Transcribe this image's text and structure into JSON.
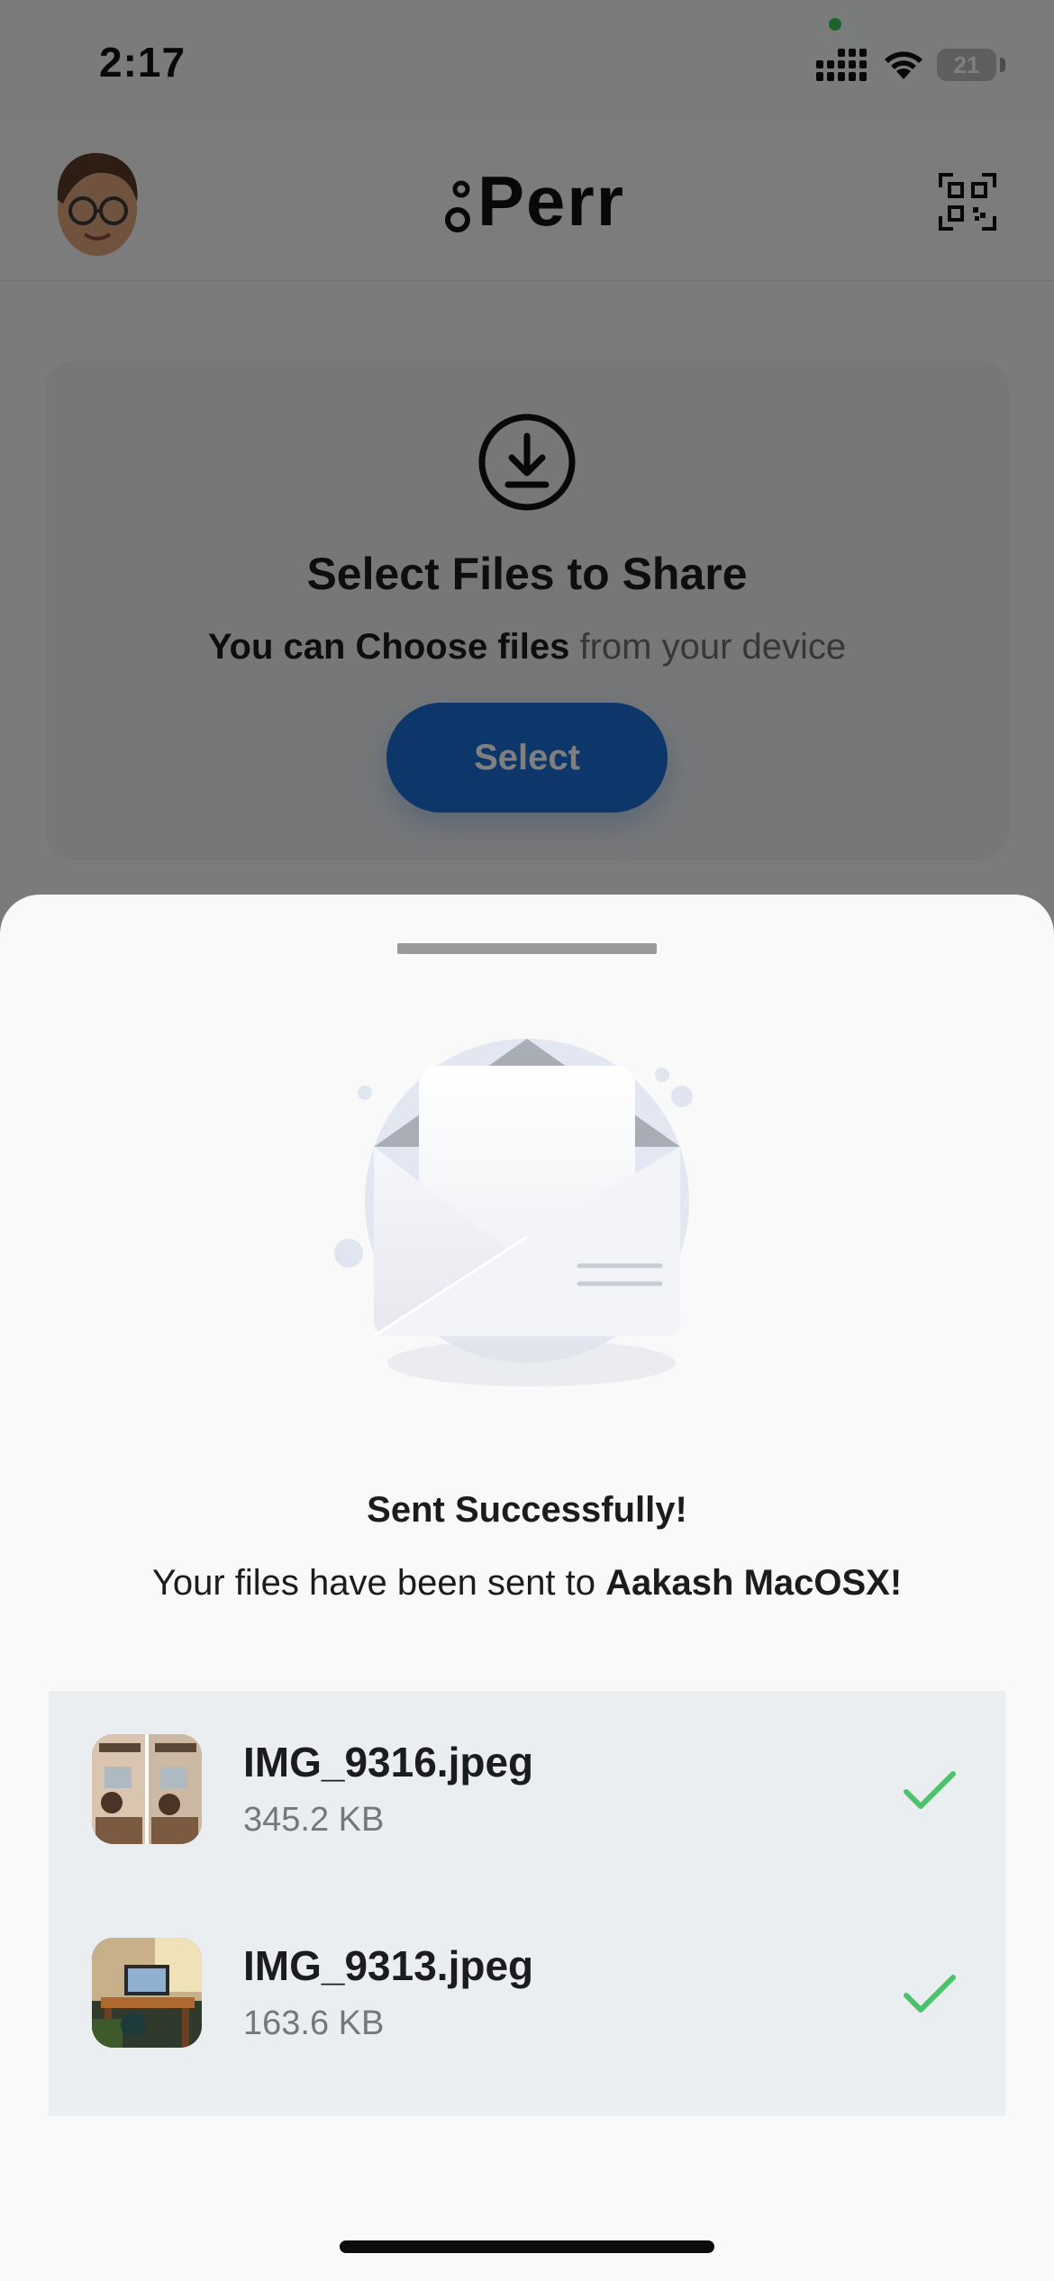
{
  "status_bar": {
    "time": "2:17",
    "battery_level": "21"
  },
  "header": {
    "logo_text": "Perr",
    "avatar_icon": "memoji-avatar",
    "qr_icon": "qr-code-scan-icon"
  },
  "select_card": {
    "icon": "download-icon",
    "title": "Select Files to Share",
    "subtitle_bold": "You can Choose files",
    "subtitle_rest": "from your device",
    "button_label": "Select"
  },
  "sheet": {
    "illustration": "open-envelope-illustration",
    "title": "Sent Successfully!",
    "message_prefix": "Your files have been sent to",
    "recipient": "Aakash MacOSX!",
    "files": [
      {
        "name": "IMG_9316.jpeg",
        "size": "345.2 KB",
        "status_icon": "checkmark-icon"
      },
      {
        "name": "IMG_9313.jpeg",
        "size": "163.6 KB",
        "status_icon": "checkmark-icon"
      }
    ]
  },
  "colors": {
    "accent_blue": "#1a6fd6",
    "success_green": "#4cc36a",
    "overlay": "rgba(0,0,0,0.5)"
  }
}
